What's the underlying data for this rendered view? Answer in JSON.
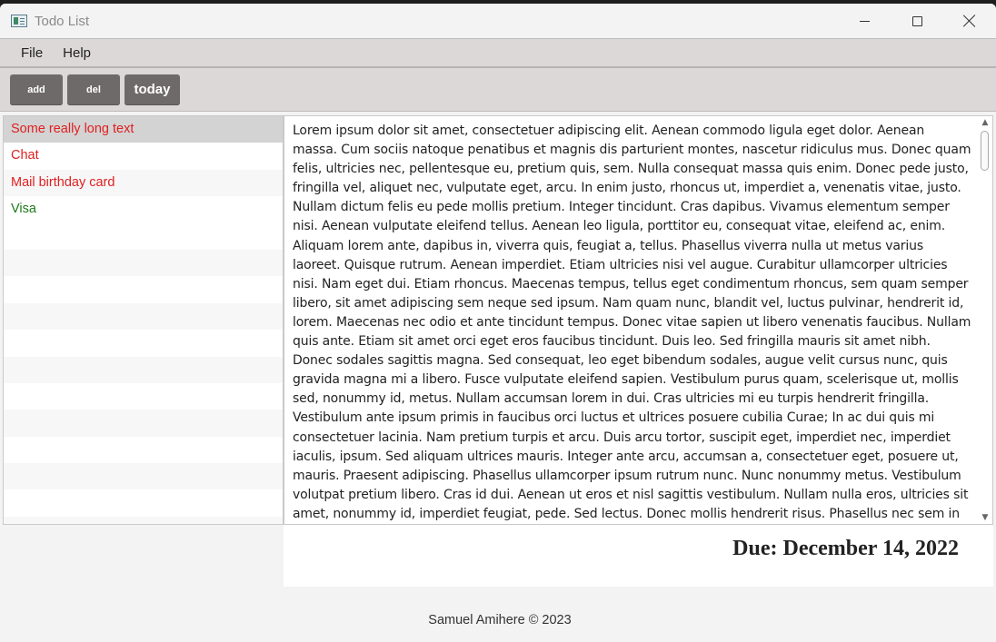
{
  "window": {
    "title": "Todo List"
  },
  "menu": {
    "items": [
      "File",
      "Help"
    ]
  },
  "toolbar": {
    "add_label": "add",
    "del_label": "del",
    "today_label": "today"
  },
  "todos": {
    "items": [
      {
        "label": "Some really long text",
        "color": "#e02020",
        "selected": true
      },
      {
        "label": "Chat",
        "color": "#e02020",
        "selected": false
      },
      {
        "label": "Mail birthday card",
        "color": "#e02020",
        "selected": false
      },
      {
        "label": "Visa",
        "color": "#1d7a1d",
        "selected": false
      }
    ]
  },
  "details": {
    "body": "Lorem ipsum dolor sit amet, consectetuer adipiscing elit. Aenean commodo ligula eget dolor. Aenean massa. Cum sociis natoque penatibus et magnis dis parturient montes, nascetur ridiculus mus. Donec quam felis, ultricies nec, pellentesque eu, pretium quis, sem. Nulla consequat massa quis enim. Donec pede justo, fringilla vel, aliquet nec, vulputate eget, arcu. In enim justo, rhoncus ut, imperdiet a, venenatis vitae, justo. Nullam dictum felis eu pede mollis pretium. Integer tincidunt. Cras dapibus. Vivamus elementum semper nisi. Aenean vulputate eleifend tellus. Aenean leo ligula, porttitor eu, consequat vitae, eleifend ac, enim. Aliquam lorem ante, dapibus in, viverra quis, feugiat a, tellus. Phasellus viverra nulla ut metus varius laoreet. Quisque rutrum. Aenean imperdiet. Etiam ultricies nisi vel augue. Curabitur ullamcorper ultricies nisi. Nam eget dui. Etiam rhoncus. Maecenas tempus, tellus eget condimentum rhoncus, sem quam semper libero, sit amet adipiscing sem neque sed ipsum. Nam quam nunc, blandit vel, luctus pulvinar, hendrerit id, lorem. Maecenas nec odio et ante tincidunt tempus. Donec vitae sapien ut libero venenatis faucibus. Nullam quis ante. Etiam sit amet orci eget eros faucibus tincidunt. Duis leo. Sed fringilla mauris sit amet nibh. Donec sodales sagittis magna. Sed consequat, leo eget bibendum sodales, augue velit cursus nunc, quis gravida magna mi a libero. Fusce vulputate eleifend sapien. Vestibulum purus quam, scelerisque ut, mollis sed, nonummy id, metus. Nullam accumsan lorem in dui. Cras ultricies mi eu turpis hendrerit fringilla. Vestibulum ante ipsum primis in faucibus orci luctus et ultrices posuere cubilia Curae; In ac dui quis mi consectetuer lacinia. Nam pretium turpis et arcu. Duis arcu tortor, suscipit eget, imperdiet nec, imperdiet iaculis, ipsum. Sed aliquam ultrices mauris. Integer ante arcu, accumsan a, consectetuer eget, posuere ut, mauris. Praesent adipiscing. Phasellus ullamcorper ipsum rutrum nunc. Nunc nonummy metus. Vestibulum volutpat pretium libero. Cras id dui. Aenean ut eros et nisl sagittis vestibulum. Nullam nulla eros, ultricies sit amet, nonummy id, imperdiet feugiat, pede. Sed lectus. Donec mollis hendrerit risus. Phasellus nec sem in justo pellentesque facilisis. Etiam imperdiet imperdiet orci. Nunc nec neque. Phasellus leo dolor, tempus",
    "due": "Due: December 14, 2022"
  },
  "footer": {
    "text": "Samuel Amihere © 2023"
  },
  "icons": {
    "app": "app-icon",
    "minimize": "minimize-icon",
    "maximize": "maximize-icon",
    "close": "close-icon",
    "scroll_up": "scroll-up-arrow-icon",
    "scroll_down": "scroll-down-arrow-icon"
  }
}
